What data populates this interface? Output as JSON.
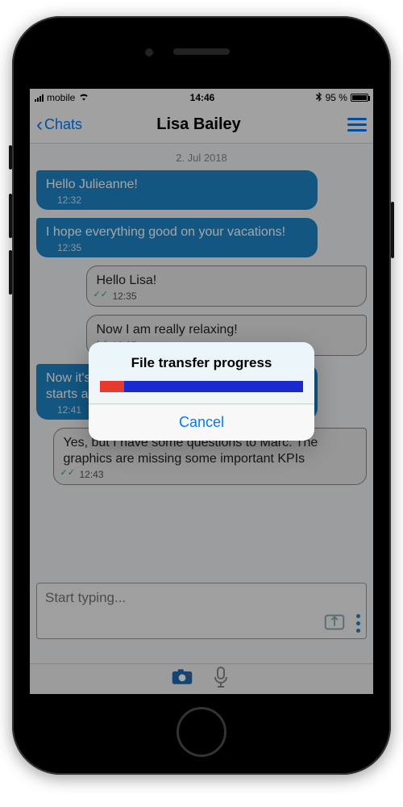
{
  "statusbar": {
    "carrier": "mobile",
    "time": "14:46",
    "battery_pct": "95 %",
    "bluetooth": "✱"
  },
  "nav": {
    "back_label": "Chats",
    "title": "Lisa Bailey"
  },
  "chat": {
    "date": "2. Jul 2018",
    "messages": [
      {
        "side": "in",
        "text": "Hello Julieanne!",
        "time": "12:32"
      },
      {
        "side": "in",
        "text": "I hope everything good on your vacations!",
        "time": "12:35"
      },
      {
        "side": "out",
        "text": "Hello Lisa!",
        "time": "12:35"
      },
      {
        "side": "out",
        "text": "Now I am really relaxing!",
        "time": "12:37"
      },
      {
        "side": "in",
        "text": "Now it's time for getting back :) Working starts already!",
        "time": "12:41"
      },
      {
        "side": "out",
        "text": "Yes, but I have some questions to Marc. The graphics are missing some important KPIs",
        "time": "12:43"
      }
    ]
  },
  "compose": {
    "placeholder": "Start typing..."
  },
  "modal": {
    "title": "File transfer progress",
    "cancel_label": "Cancel",
    "progress_red_pct": 12,
    "progress_blue_pct": 88
  }
}
